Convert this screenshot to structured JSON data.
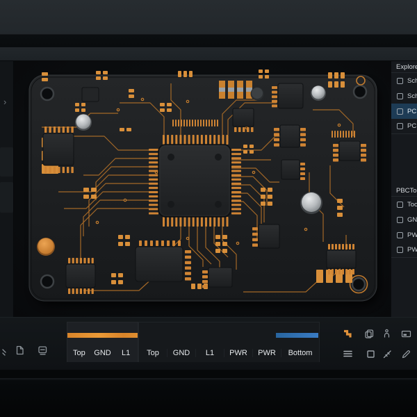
{
  "colors": {
    "accent_orange": "#e0913a",
    "accent_blue": "#3577c4",
    "selection_blue": "#1d3b55",
    "board_substrate": "#1d1f22",
    "copper_trace": "#b06f28",
    "pad_orange": "#cf8434"
  },
  "left_sidebar": {
    "chevron": "›"
  },
  "right_panel": {
    "sections": [
      {
        "title": "Explore",
        "items": [
          {
            "label": "Sch",
            "selected": false
          },
          {
            "label": "Sch",
            "selected": false
          },
          {
            "label": "PC",
            "selected": true
          },
          {
            "label": "PC",
            "selected": false
          }
        ]
      },
      {
        "title": "PBCToo",
        "items": [
          {
            "label": "Too",
            "selected": false
          },
          {
            "label": "GN",
            "selected": false
          },
          {
            "label": "PW",
            "selected": false
          },
          {
            "label": "PW",
            "selected": false
          }
        ]
      }
    ]
  },
  "bottom_bar": {
    "layer_groups": [
      {
        "labels": [
          "Top",
          "GND",
          "L1"
        ],
        "indicator_color": "#e0913a"
      },
      {
        "labels": [
          "Top",
          "GND",
          "L1",
          "PWR",
          "PWR",
          "Bottom"
        ],
        "active_label": "Bottom",
        "indicator_color": "#3577c4"
      }
    ],
    "icons_left": [
      "edge-tool-icon",
      "new-document-icon",
      "library-icon"
    ],
    "icons_right_row1": [
      "route-icon",
      "component-icon",
      "pin-icon",
      "board-icon"
    ],
    "icons_right_row2": [
      "layers-icon",
      "rectangle-icon",
      "measure-icon",
      "pencil-icon"
    ]
  }
}
